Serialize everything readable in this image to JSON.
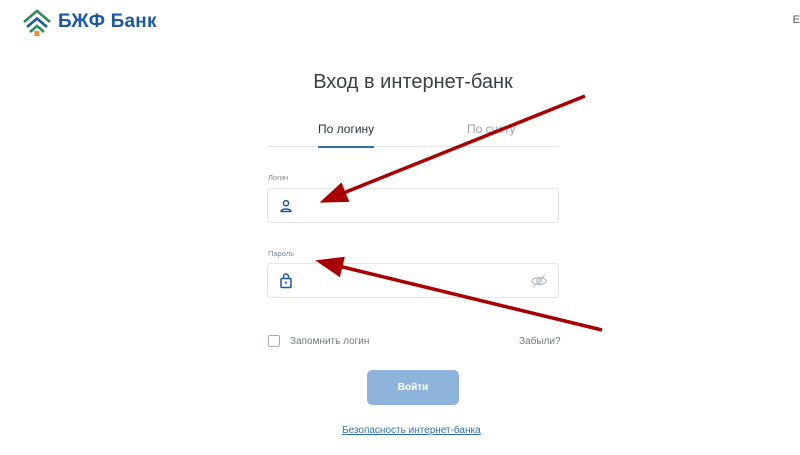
{
  "header": {
    "logo_text": "БЖФ Банк",
    "corner_char": "E"
  },
  "page": {
    "title": "Вход в интернет-банк"
  },
  "tabs": [
    {
      "label": "По логину",
      "active": true
    },
    {
      "label": "По счету",
      "active": false
    }
  ],
  "form": {
    "login_label": "Логин",
    "login_value": "",
    "password_label": "Пароль",
    "password_value": "",
    "remember_label": "Запомнить логин",
    "remember_checked": false,
    "forgot_label": "Забыли?",
    "submit_label": "Войти"
  },
  "footer": {
    "security_link": "Безопасность интернет-банка"
  },
  "colors": {
    "brand_blue": "#1c5aa6",
    "brand_green": "#2e8b57",
    "accent_orange": "#f08a24",
    "button_disabled": "#8fb4dc",
    "annotation_red": "#a80000"
  },
  "icons": {
    "login_field": "user-icon",
    "password_field": "lock-icon",
    "password_toggle": "eye-off-icon"
  }
}
